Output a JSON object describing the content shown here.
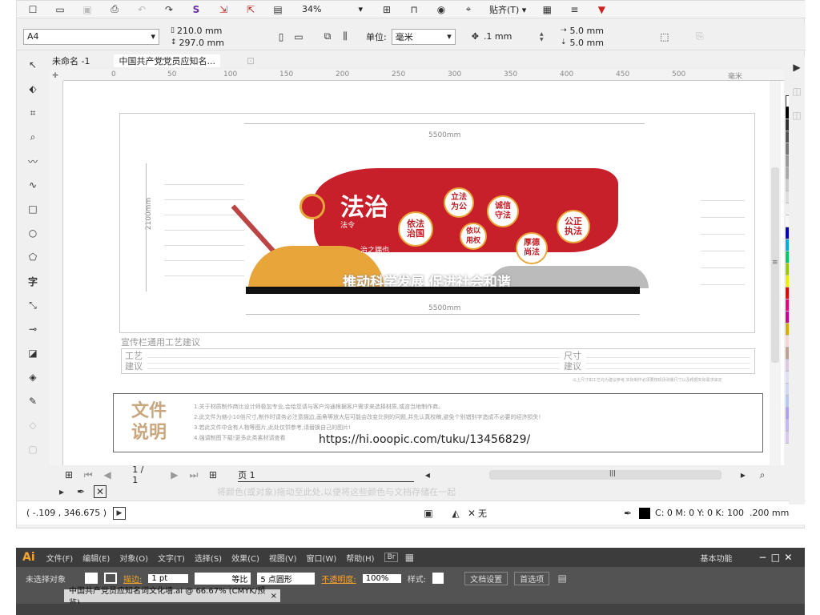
{
  "toolbar1": {
    "zoom": "34%",
    "snap": "贴齐(T)"
  },
  "propbar": {
    "page_size": "A4",
    "width": "210.0 mm",
    "height": "297.0 mm",
    "unit_label": "单位:",
    "unit": "毫米",
    "nudge": ".1 mm",
    "dup_x": "5.0 mm",
    "dup_y": "5.0 mm"
  },
  "tabs": [
    {
      "label": "未命名 -1"
    },
    {
      "label": "中国共产党党员应知名..."
    }
  ],
  "ruler_ticks": [
    "0",
    "50",
    "100",
    "150",
    "200",
    "250",
    "300",
    "350",
    "400",
    "450",
    "500",
    "毫米"
  ],
  "design": {
    "dim_top": "5500mm",
    "dim_bottom": "5500mm",
    "dim_side": "2100mm",
    "title_main": "法治",
    "title_sub1": "法令",
    "title_sub2": "治之端也",
    "circles": [
      {
        "text": "依法\n治国"
      },
      {
        "text": "立法\n为公"
      },
      {
        "text": "诚信\n守法"
      },
      {
        "text": "公正\n执法"
      },
      {
        "text": "依以\n用权"
      },
      {
        "text": "厚德\n尚法"
      }
    ],
    "slogan": "推动科学发展 促进社会和谐",
    "craft_heading": "宣传栏通用工艺建议",
    "craft_label": "工艺\n建议",
    "size_label": "尺寸\n建议",
    "size_note": "以上尺寸如工艺均为建议参考,实际制作必须要按现场测量尺寸以及根据实际需求来定",
    "doc_label": "文件\n说明",
    "doc_lines": [
      "1.关于材质制作商比设计师极加专业,会给您请与客户沟通根据客户需求来选择材质,或咨当地制作商。",
      "2.此文件为缩小10倍尺寸,制作时请务必注意描边,画角等放大后可能会改变比例的问题,并先认真校稿,避免个别错别字造成不必要的经济损失!",
      "3.若此文件中含有人物等图片,此处仅供参考,请替换自己的图片!",
      "4.强调制图下载!更多此类素材请查看"
    ],
    "url": "https://hi.ooopic.com/tuku/13456829/"
  },
  "pager": {
    "page_count": "1 / 1",
    "page_tab": "页 1"
  },
  "status": {
    "coords": "( -.109 , 346.675 )",
    "fill_none": "无",
    "outline": "C: 0 M: 0 Y: 0 K: 100  .200 mm",
    "hint": "将颜色(或对象)拖动至此处,以便将这些颜色与文档存储在一起"
  },
  "palette": [
    "#ffffff",
    "#000000",
    "#333333",
    "#555555",
    "#777777",
    "#999999",
    "#aaaaaa",
    "#cccccc",
    "#dddddd",
    "#eeeeee",
    "#f7f7f7",
    "#0000cc",
    "#00aaee",
    "#00cc66",
    "#99cc00",
    "#eeee00",
    "#ee0000",
    "#ee0077",
    "#cc0099",
    "#ddaa00",
    "#f5d5d5",
    "#c0a090",
    "#e0c8e0",
    "#e0e0f5",
    "#d0d8f5",
    "#b8c8f0",
    "#b0a0f0",
    "#c8b8f0",
    "#d8c8f0"
  ],
  "ai": {
    "logo": "Ai",
    "menus": [
      "文件(F)",
      "编辑(E)",
      "对象(O)",
      "文字(T)",
      "选择(S)",
      "效果(C)",
      "视图(V)",
      "窗口(W)",
      "帮助(H)"
    ],
    "workspace": "基本功能",
    "selection": "未选择对象",
    "stroke_label": "描边:",
    "stroke_w": "1 pt",
    "line": "等比",
    "brush": "5 点圆形",
    "opacity_label": "不透明度:",
    "opacity": "100%",
    "style_label": "样式:",
    "doc_setup": "文档设置",
    "prefs": "首选项",
    "doc_tab": "中国共产党员应知名词文化墙.ai @ 66.67% (CMYK/预览)"
  },
  "colors": {
    "red": "#c8202a",
    "gold": "#e8a53a",
    "ai_bg": "#535353"
  }
}
